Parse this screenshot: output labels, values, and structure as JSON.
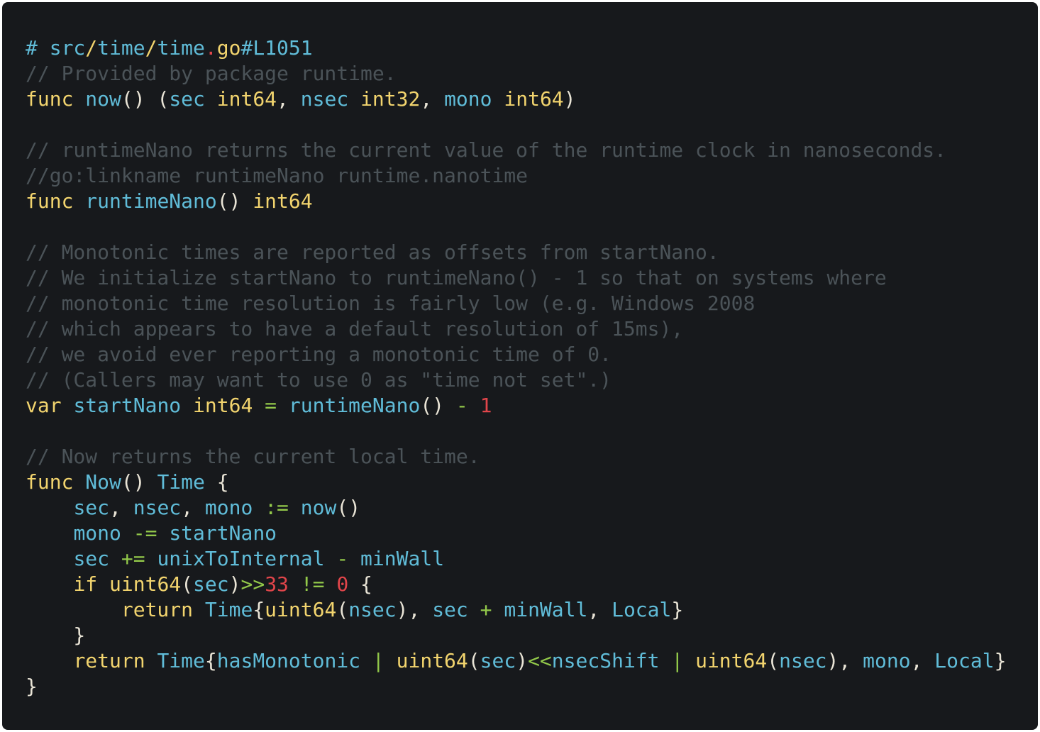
{
  "colors": {
    "background": "#17191c",
    "comment": "#4b5358",
    "keyword": "#f2d46e",
    "type": "#f2d46e",
    "ident": "#60bcd8",
    "operator": "#93c94a",
    "number": "#e0454a",
    "punct": "#e9e4d6",
    "path": "#f2d46e",
    "hash": "#60bcd8",
    "dot": "#e0454a"
  },
  "code": {
    "lines": [
      [
        [
          "hash",
          "# "
        ],
        [
          "ident",
          "src"
        ],
        [
          "path",
          "/"
        ],
        [
          "ident",
          "time"
        ],
        [
          "path",
          "/"
        ],
        [
          "ident",
          "time"
        ],
        [
          "dot",
          "."
        ],
        [
          "path",
          "go"
        ],
        [
          "ident",
          "#L1051"
        ]
      ],
      [
        [
          "comment",
          "// Provided by package runtime."
        ]
      ],
      [
        [
          "keyword",
          "func "
        ],
        [
          "ident",
          "now"
        ],
        [
          "punct",
          "() ("
        ],
        [
          "ident",
          "sec"
        ],
        [
          "punct",
          " "
        ],
        [
          "type",
          "int64"
        ],
        [
          "punct",
          ", "
        ],
        [
          "ident",
          "nsec"
        ],
        [
          "punct",
          " "
        ],
        [
          "type",
          "int32"
        ],
        [
          "punct",
          ", "
        ],
        [
          "ident",
          "mono"
        ],
        [
          "punct",
          " "
        ],
        [
          "type",
          "int64"
        ],
        [
          "punct",
          ")"
        ]
      ],
      [],
      [
        [
          "comment",
          "// runtimeNano returns the current value of the runtime clock in nanoseconds."
        ]
      ],
      [
        [
          "comment",
          "//go:linkname runtimeNano runtime.nanotime"
        ]
      ],
      [
        [
          "keyword",
          "func "
        ],
        [
          "ident",
          "runtimeNano"
        ],
        [
          "punct",
          "() "
        ],
        [
          "type",
          "int64"
        ]
      ],
      [],
      [
        [
          "comment",
          "// Monotonic times are reported as offsets from startNano."
        ]
      ],
      [
        [
          "comment",
          "// We initialize startNano to runtimeNano() - 1 so that on systems where"
        ]
      ],
      [
        [
          "comment",
          "// monotonic time resolution is fairly low (e.g. Windows 2008"
        ]
      ],
      [
        [
          "comment",
          "// which appears to have a default resolution of 15ms),"
        ]
      ],
      [
        [
          "comment",
          "// we avoid ever reporting a monotonic time of 0."
        ]
      ],
      [
        [
          "comment",
          "// (Callers may want to use 0 as \"time not set\".)"
        ]
      ],
      [
        [
          "keyword",
          "var "
        ],
        [
          "ident",
          "startNano"
        ],
        [
          "punct",
          " "
        ],
        [
          "type",
          "int64"
        ],
        [
          "punct",
          " "
        ],
        [
          "operator",
          "="
        ],
        [
          "punct",
          " "
        ],
        [
          "ident",
          "runtimeNano"
        ],
        [
          "punct",
          "() "
        ],
        [
          "operator",
          "-"
        ],
        [
          "punct",
          " "
        ],
        [
          "number",
          "1"
        ]
      ],
      [],
      [
        [
          "comment",
          "// Now returns the current local time."
        ]
      ],
      [
        [
          "keyword",
          "func "
        ],
        [
          "ident",
          "Now"
        ],
        [
          "punct",
          "() "
        ],
        [
          "ident",
          "Time"
        ],
        [
          "punct",
          " {"
        ]
      ],
      [
        [
          "punct",
          "    "
        ],
        [
          "ident",
          "sec"
        ],
        [
          "punct",
          ", "
        ],
        [
          "ident",
          "nsec"
        ],
        [
          "punct",
          ", "
        ],
        [
          "ident",
          "mono"
        ],
        [
          "punct",
          " "
        ],
        [
          "operator",
          ":="
        ],
        [
          "punct",
          " "
        ],
        [
          "ident",
          "now"
        ],
        [
          "punct",
          "()"
        ]
      ],
      [
        [
          "punct",
          "    "
        ],
        [
          "ident",
          "mono"
        ],
        [
          "punct",
          " "
        ],
        [
          "operator",
          "-="
        ],
        [
          "punct",
          " "
        ],
        [
          "ident",
          "startNano"
        ]
      ],
      [
        [
          "punct",
          "    "
        ],
        [
          "ident",
          "sec"
        ],
        [
          "punct",
          " "
        ],
        [
          "operator",
          "+="
        ],
        [
          "punct",
          " "
        ],
        [
          "ident",
          "unixToInternal"
        ],
        [
          "punct",
          " "
        ],
        [
          "operator",
          "-"
        ],
        [
          "punct",
          " "
        ],
        [
          "ident",
          "minWall"
        ]
      ],
      [
        [
          "punct",
          "    "
        ],
        [
          "keyword",
          "if "
        ],
        [
          "type",
          "uint64"
        ],
        [
          "punct",
          "("
        ],
        [
          "ident",
          "sec"
        ],
        [
          "punct",
          ")"
        ],
        [
          "operator",
          ">>"
        ],
        [
          "number",
          "33"
        ],
        [
          "punct",
          " "
        ],
        [
          "operator",
          "!="
        ],
        [
          "punct",
          " "
        ],
        [
          "number",
          "0"
        ],
        [
          "punct",
          " {"
        ]
      ],
      [
        [
          "punct",
          "        "
        ],
        [
          "keyword",
          "return "
        ],
        [
          "ident",
          "Time"
        ],
        [
          "punct",
          "{"
        ],
        [
          "type",
          "uint64"
        ],
        [
          "punct",
          "("
        ],
        [
          "ident",
          "nsec"
        ],
        [
          "punct",
          "), "
        ],
        [
          "ident",
          "sec"
        ],
        [
          "punct",
          " "
        ],
        [
          "operator",
          "+"
        ],
        [
          "punct",
          " "
        ],
        [
          "ident",
          "minWall"
        ],
        [
          "punct",
          ", "
        ],
        [
          "ident",
          "Local"
        ],
        [
          "punct",
          "}"
        ]
      ],
      [
        [
          "punct",
          "    }"
        ]
      ],
      [
        [
          "punct",
          "    "
        ],
        [
          "keyword",
          "return "
        ],
        [
          "ident",
          "Time"
        ],
        [
          "punct",
          "{"
        ],
        [
          "ident",
          "hasMonotonic"
        ],
        [
          "punct",
          " "
        ],
        [
          "operator",
          "|"
        ],
        [
          "punct",
          " "
        ],
        [
          "type",
          "uint64"
        ],
        [
          "punct",
          "("
        ],
        [
          "ident",
          "sec"
        ],
        [
          "punct",
          ")"
        ],
        [
          "operator",
          "<<"
        ],
        [
          "ident",
          "nsecShift"
        ],
        [
          "punct",
          " "
        ],
        [
          "operator",
          "|"
        ],
        [
          "punct",
          " "
        ],
        [
          "type",
          "uint64"
        ],
        [
          "punct",
          "("
        ],
        [
          "ident",
          "nsec"
        ],
        [
          "punct",
          "), "
        ],
        [
          "ident",
          "mono"
        ],
        [
          "punct",
          ", "
        ],
        [
          "ident",
          "Local"
        ],
        [
          "punct",
          "}"
        ]
      ],
      [
        [
          "punct",
          "}"
        ]
      ]
    ]
  }
}
